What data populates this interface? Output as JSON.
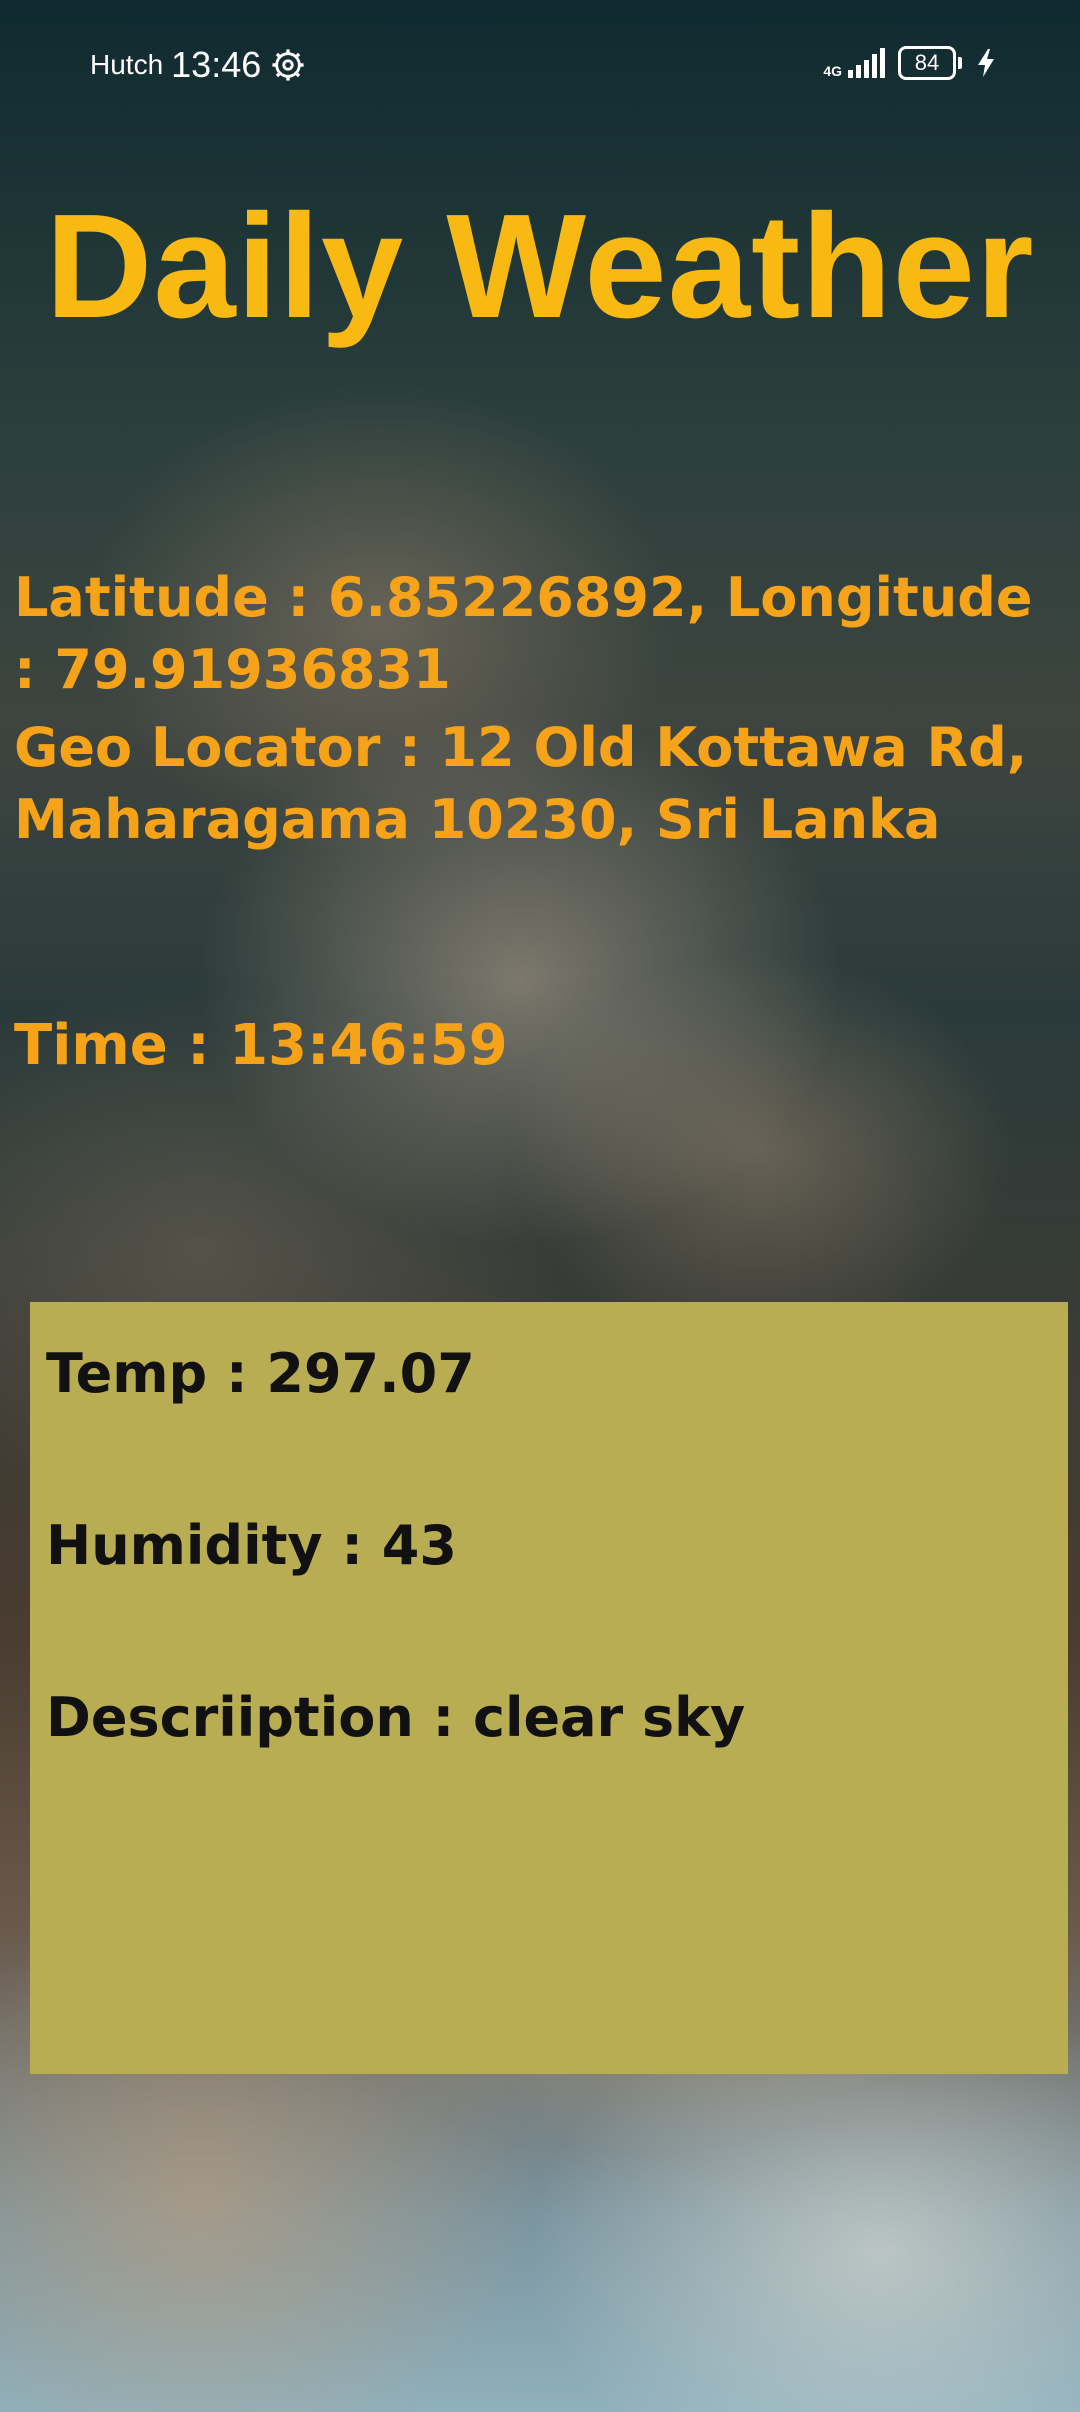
{
  "status_bar": {
    "carrier": "Hutch",
    "time": "13:46",
    "network": "4G",
    "battery": "84"
  },
  "title": "Daily Weather",
  "location": {
    "latlon_text": "Latitude : 6.85226892, Longitude : 79.91936831",
    "geo_text": "Geo Locator : 12 Old Kottawa Rd, Maharagama 10230, Sri Lanka"
  },
  "time_text": "Time : 13:46:59",
  "weather": {
    "temp_text": "Temp : 297.07",
    "humidity_text": "Humidity : 43",
    "description_text": "Descriiption : clear sky"
  },
  "colors": {
    "title": "#f8b912",
    "info_text": "#f6a319",
    "card_bg": "#b9ad53"
  },
  "icons": {
    "status_settings": "gear-icon",
    "signal": "signal-icon",
    "battery": "battery-icon",
    "charging": "bolt-icon"
  }
}
